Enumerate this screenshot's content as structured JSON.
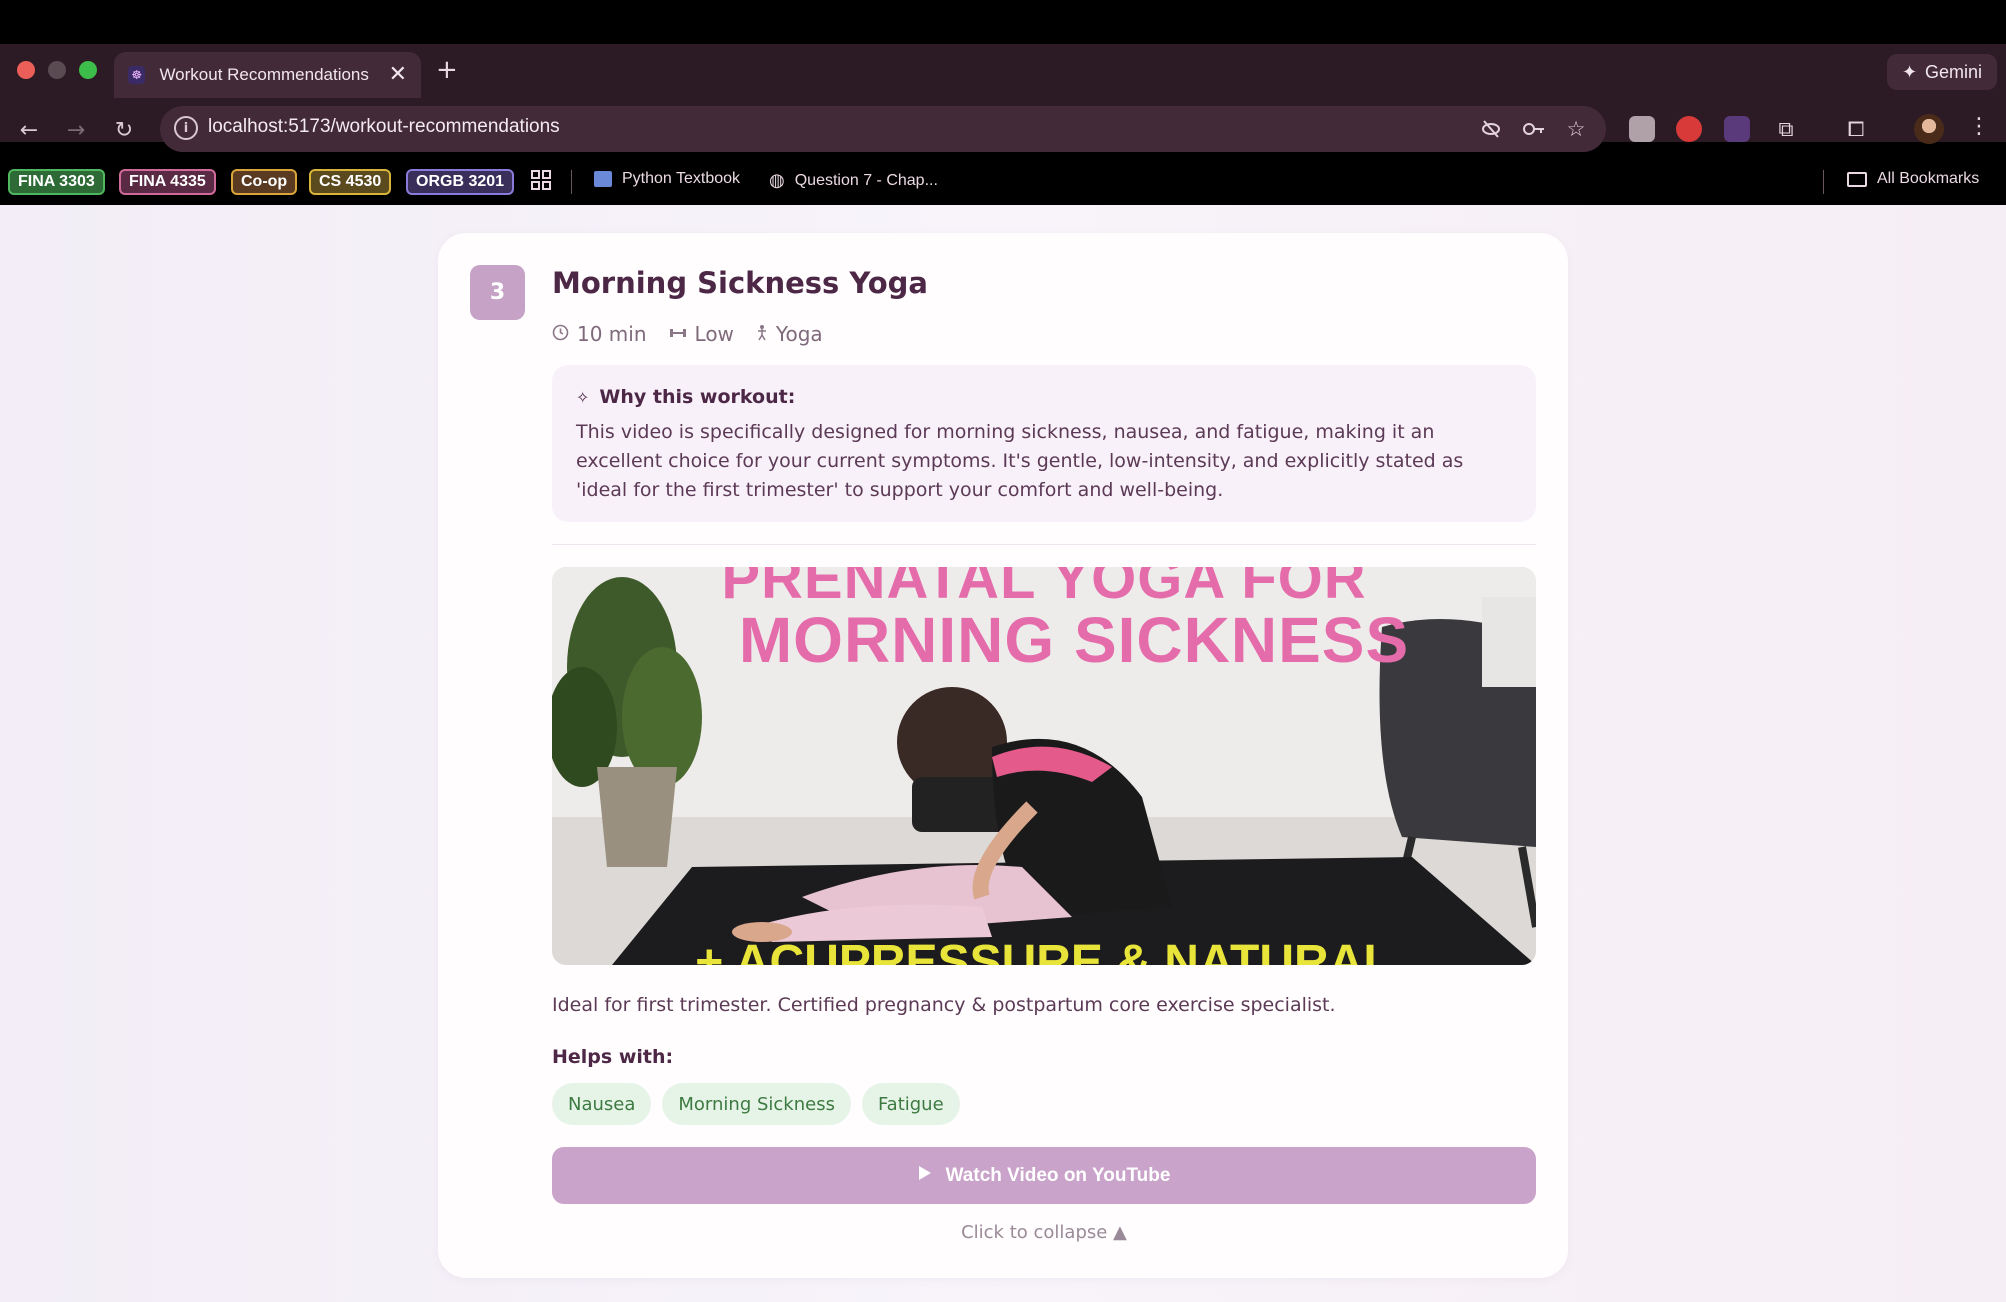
{
  "browser": {
    "tab_title": "Workout Recommendations |",
    "tab_favicon": "☸",
    "new_tab": "+",
    "close_tab": "✕",
    "gemini_label": "Gemini",
    "url": "localhost:5173/workout-recommendations",
    "bookmarks": [
      {
        "label": "FINA 3303",
        "color": "#3a9a4a"
      },
      {
        "label": "FINA 4335",
        "color": "#d06a9a"
      },
      {
        "label": "Co-op",
        "color": "#d9a43a"
      },
      {
        "label": "CS 4530",
        "color": "#d9b43a"
      },
      {
        "label": "ORGB 3201",
        "color": "#8a7ad9"
      }
    ],
    "bookmark_links": [
      "Python Textbook",
      "Question 7 - Chap..."
    ],
    "all_bookmarks": "All Bookmarks"
  },
  "workout": {
    "number": "3",
    "title": "Morning Sickness Yoga",
    "duration": "10 min",
    "intensity": "Low",
    "type": "Yoga",
    "why_heading": "Why this workout:",
    "why_text": "This video is specifically designed for morning sickness, nausea, and fatigue, making it an excellent choice for your current symptoms. It's gentle, low-intensity, and explicitly stated as 'ideal for the first trimester' to support your comfort and well-being.",
    "video_title_top": "PRENATAL YOGA FOR",
    "video_title_main": "MORNING SICKNESS",
    "video_title_bottom": "+ ACUPRESSURE & NATURAL",
    "description": "Ideal for first trimester. Certified pregnancy & postpartum core exercise specialist.",
    "helps_label": "Helps with:",
    "tags": [
      "Nausea",
      "Morning Sickness",
      "Fatigue"
    ],
    "watch_button": "Watch Video on YouTube",
    "collapse_text": "Click to collapse ▲"
  }
}
